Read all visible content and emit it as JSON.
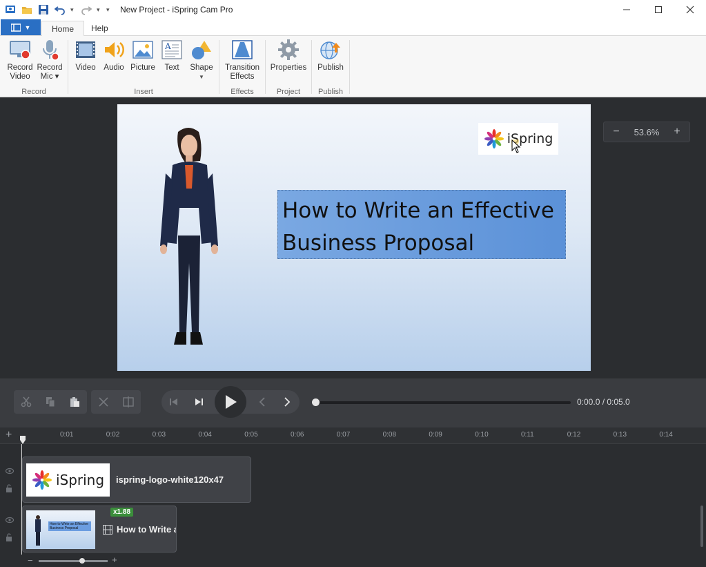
{
  "window": {
    "title": "New Project - iSpring Cam Pro"
  },
  "ribbon": {
    "tabs": [
      {
        "label": "Home",
        "active": true
      },
      {
        "label": "Help",
        "active": false
      }
    ],
    "groups": {
      "record": "Record",
      "insert": "Insert",
      "effects": "Effects",
      "project": "Project",
      "publish": "Publish"
    },
    "buttons": {
      "record_video_1": "Record",
      "record_video_2": "Video",
      "record_mic_1": "Record",
      "record_mic_2": "Mic ▾",
      "video": "Video",
      "audio": "Audio",
      "picture": "Picture",
      "text": "Text",
      "shape": "Shape",
      "transition_1": "Transition",
      "transition_2": "Effects",
      "properties": "Properties",
      "publish": "Publish"
    }
  },
  "slide": {
    "logo_text": "iSpring",
    "title_line1": "How to Write an Effective",
    "title_line2": "Business Proposal"
  },
  "zoom": {
    "minus": "−",
    "value": "53.6%",
    "plus": "+"
  },
  "playback": {
    "timecode": "0:00.0 / 0:05.0",
    "progress": 0
  },
  "timeline": {
    "ruler_ticks": [
      "0:01",
      "0:02",
      "0:03",
      "0:04",
      "0:05",
      "0:06",
      "0:07",
      "0:08",
      "0:09",
      "0:10",
      "0:11",
      "0:12",
      "0:13",
      "0:14"
    ],
    "clip1": {
      "logo_text": "iSpring",
      "name": "ispring-logo-white120x47"
    },
    "clip2": {
      "name": "How to Write a",
      "speed": "x1.88",
      "thumb_text": "How to Write an Effective Business Proposal"
    }
  },
  "colors": {
    "accent": "#2a6fc4",
    "title_box": "#6b9de0",
    "speed_badge": "#3b8f3b"
  }
}
